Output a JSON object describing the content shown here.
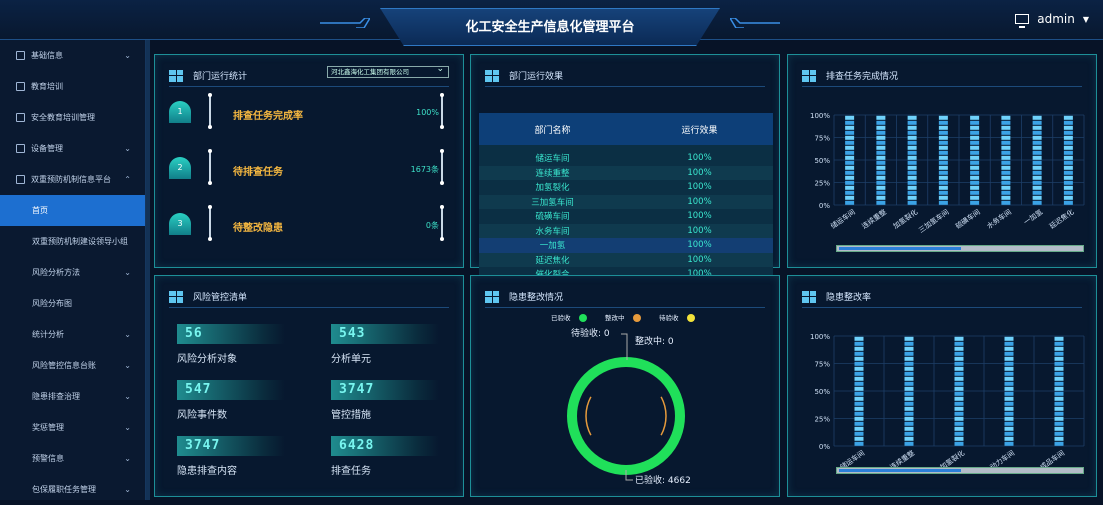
{
  "app": {
    "title": "化工安全生产信息化管理平台",
    "user": "admin"
  },
  "sidebar": {
    "items": [
      {
        "label": "基础信息",
        "icon": "info-icon",
        "chev": "⌄",
        "sub": false
      },
      {
        "label": "教育培训",
        "icon": "book-icon",
        "chev": "",
        "sub": false
      },
      {
        "label": "安全教育培训管理",
        "icon": "training-icon",
        "chev": "",
        "sub": false
      },
      {
        "label": "设备管理",
        "icon": "device-icon",
        "chev": "⌄",
        "sub": false
      },
      {
        "label": "双重预防机制信息平台",
        "icon": "shield-icon",
        "chev": "⌃",
        "sub": false
      },
      {
        "label": "首页",
        "icon": "",
        "chev": "",
        "sub": true,
        "active": true
      },
      {
        "label": "双重预防机制建设领导小组",
        "icon": "",
        "chev": "",
        "sub": true
      },
      {
        "label": "风险分析方法",
        "icon": "",
        "chev": "⌄",
        "sub": true
      },
      {
        "label": "风险分布图",
        "icon": "",
        "chev": "",
        "sub": true
      },
      {
        "label": "统计分析",
        "icon": "",
        "chev": "⌄",
        "sub": true
      },
      {
        "label": "风险管控信息台账",
        "icon": "",
        "chev": "⌄",
        "sub": true
      },
      {
        "label": "隐患排查治理",
        "icon": "",
        "chev": "⌄",
        "sub": true
      },
      {
        "label": "奖惩管理",
        "icon": "",
        "chev": "⌄",
        "sub": true
      },
      {
        "label": "预警信息",
        "icon": "",
        "chev": "⌄",
        "sub": true
      },
      {
        "label": "包保履职任务管理",
        "icon": "",
        "chev": "⌄",
        "sub": true
      }
    ]
  },
  "panels": {
    "dept_stats": {
      "title": "部门运行统计",
      "company": "河北鑫海化工集团有限公司",
      "rows": [
        {
          "no": "1",
          "label": "排查任务完成率",
          "value": "100%"
        },
        {
          "no": "2",
          "label": "待排查任务",
          "value": "1673条"
        },
        {
          "no": "3",
          "label": "待整改隐患",
          "value": "0条"
        }
      ]
    },
    "dept_effect": {
      "title": "部门运行效果",
      "col1": "部门名称",
      "col2": "运行效果",
      "rows": [
        [
          "储运车间",
          "100%"
        ],
        [
          "连续重整",
          "100%"
        ],
        [
          "加氢裂化",
          "100%"
        ],
        [
          "三加氢车间",
          "100%"
        ],
        [
          "硫磺车间",
          "100%"
        ],
        [
          "水务车间",
          "100%"
        ],
        [
          "一加氢",
          "100%"
        ],
        [
          "延迟焦化",
          "100%"
        ],
        [
          "催化裂合",
          "100%"
        ]
      ]
    },
    "task_done": {
      "title": "排查任务完成情况"
    },
    "risk_list": {
      "title": "风险管控清单",
      "items": [
        {
          "num": "56",
          "label": "风险分析对象"
        },
        {
          "num": "543",
          "label": "分析单元"
        },
        {
          "num": "547",
          "label": "风险事件数"
        },
        {
          "num": "3747",
          "label": "管控措施"
        },
        {
          "num": "3747",
          "label": "隐患排查内容"
        },
        {
          "num": "6428",
          "label": "排查任务"
        }
      ]
    },
    "rectify": {
      "title": "隐患整改情况",
      "legend": [
        {
          "label": "已验收",
          "color": "#20e05a"
        },
        {
          "label": "整改中",
          "color": "#e69a3c"
        },
        {
          "label": "待验收",
          "color": "#f2e23a"
        }
      ],
      "ann_wait": "待验收: 0",
      "ann_doing": "整改中: 0",
      "ann_done": "已验收: 4662"
    },
    "rectify_rate": {
      "title": "隐患整改率"
    }
  },
  "chart_data": [
    {
      "type": "bar",
      "title": "排查任务完成情况",
      "categories": [
        "储运车间",
        "连续重整",
        "加氢裂化",
        "三加氢车间",
        "硫磺车间",
        "水务车间",
        "一加氢",
        "延迟焦化"
      ],
      "values": [
        100,
        100,
        100,
        100,
        100,
        100,
        100,
        100
      ],
      "ylim": [
        0,
        100
      ],
      "yticks": [
        "0%",
        "25%",
        "50%",
        "75%",
        "100%"
      ],
      "grid": true
    },
    {
      "type": "pie",
      "title": "隐患整改情况",
      "categories": [
        "已验收",
        "整改中",
        "待验收"
      ],
      "values": [
        4662,
        0,
        0
      ]
    },
    {
      "type": "bar",
      "title": "隐患整改率",
      "categories": [
        "储运车间",
        "连续重整",
        "加氢裂化",
        "动力车间",
        "成品车间"
      ],
      "values": [
        100,
        100,
        100,
        100,
        100
      ],
      "ylim": [
        0,
        100
      ],
      "yticks": [
        "0%",
        "25%",
        "50%",
        "75%",
        "100%"
      ],
      "grid": true
    }
  ],
  "colors": {
    "accent": "#1d6fd0",
    "teal": "#3ae7cf",
    "gold": "#f3b640",
    "bar": "#4fb8f0"
  }
}
